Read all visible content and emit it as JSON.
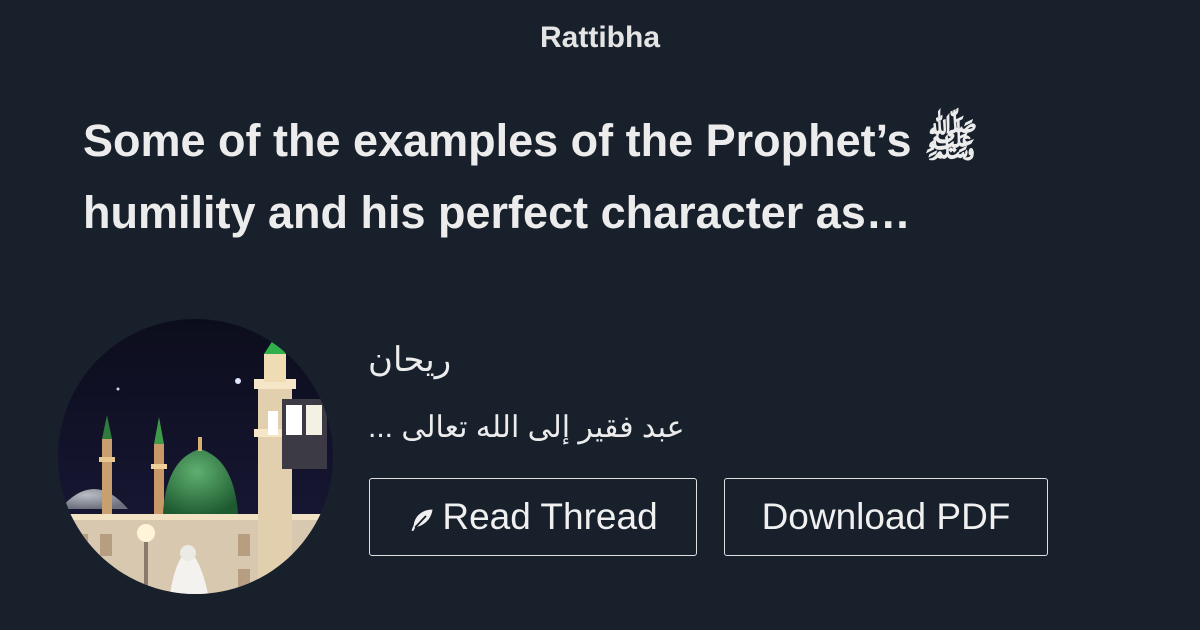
{
  "header": {
    "brand": "Rattibha"
  },
  "thread": {
    "title": "Some of the examples of the Prophet’s ﷺ humility and his perfect character as…"
  },
  "author": {
    "name": "ريحان",
    "bio": "عبد فقير إلى الله تعالى ..."
  },
  "actions": {
    "read_label": "Read Thread",
    "pdf_label": "Download PDF"
  },
  "colors": {
    "background": "#18202b",
    "text": "#ececec",
    "button_border": "#e0e0e0"
  },
  "icons": {
    "read": "feather-icon"
  }
}
